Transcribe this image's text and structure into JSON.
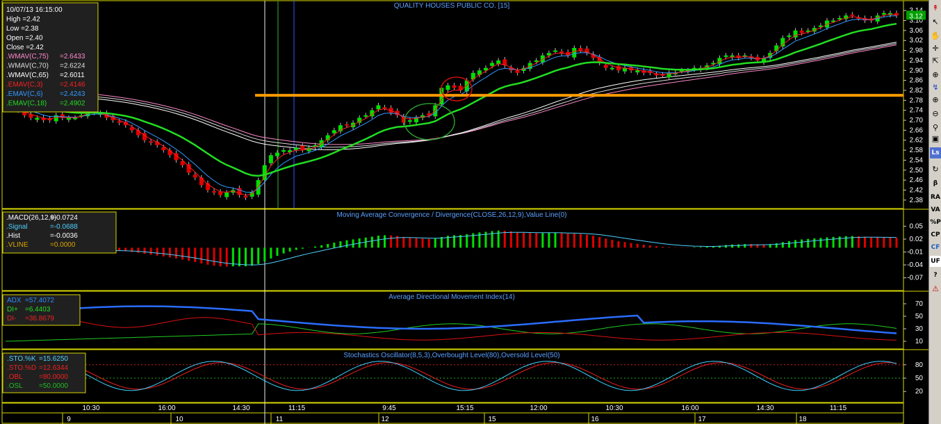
{
  "colors": {
    "background": "#000000",
    "border": "#d8d800",
    "up": "#00e000",
    "down": "#e00000",
    "title": "#5aa0ff",
    "axis_text": "#ffffff",
    "orange_level": "#ff9a00",
    "ema18": "#22dd22",
    "ema6": "#3399ff",
    "ema3": "#ff2020",
    "wmav75": "#ff88cc",
    "wmav70": "#dddddd",
    "wmav65": "#ffffff",
    "ochre": "#d9a400"
  },
  "chart_data": [
    {
      "type": "candlestick",
      "title": "QUALITY HOUSES PUBLIC CO. [15]",
      "y_ticks": [
        "3.14",
        "3.10",
        "3.06",
        "3.02",
        "2.98",
        "2.94",
        "2.90",
        "2.86",
        "2.82",
        "2.78",
        "2.74",
        "2.70",
        "2.66",
        "2.62",
        "2.58",
        "2.54",
        "2.50",
        "2.46",
        "2.42",
        "2.38"
      ],
      "last_price_label": "3.12",
      "ylim": [
        2.36,
        3.16
      ],
      "horizontal_level": 2.8,
      "closes": [
        2.77,
        2.76,
        2.74,
        2.72,
        2.71,
        2.71,
        2.7,
        2.7,
        2.72,
        2.71,
        2.71,
        2.71,
        2.72,
        2.74,
        2.73,
        2.73,
        2.71,
        2.7,
        2.69,
        2.68,
        2.66,
        2.64,
        2.62,
        2.61,
        2.6,
        2.58,
        2.56,
        2.54,
        2.52,
        2.49,
        2.47,
        2.44,
        2.42,
        2.41,
        2.4,
        2.41,
        2.42,
        2.4,
        2.39,
        2.41,
        2.46,
        2.52,
        2.56,
        2.57,
        2.58,
        2.58,
        2.59,
        2.58,
        2.59,
        2.6,
        2.62,
        2.64,
        2.66,
        2.68,
        2.68,
        2.69,
        2.71,
        2.72,
        2.74,
        2.76,
        2.75,
        2.73,
        2.72,
        2.69,
        2.7,
        2.71,
        2.72,
        2.72,
        2.76,
        2.83,
        2.84,
        2.83,
        2.82,
        2.86,
        2.89,
        2.9,
        2.91,
        2.93,
        2.94,
        2.92,
        2.9,
        2.89,
        2.91,
        2.93,
        2.94,
        2.96,
        2.97,
        2.98,
        2.97,
        2.96,
        2.99,
        2.98,
        2.97,
        2.95,
        2.93,
        2.91,
        2.91,
        2.9,
        2.91,
        2.9,
        2.9,
        2.89,
        2.89,
        2.88,
        2.88,
        2.89,
        2.89,
        2.9,
        2.9,
        2.91,
        2.91,
        2.92,
        2.93,
        2.95,
        2.96,
        2.96,
        2.95,
        2.96,
        2.95,
        2.94,
        2.95,
        2.97,
        3.0,
        3.03,
        3.04,
        3.06,
        3.05,
        3.06,
        3.07,
        3.08,
        3.1,
        3.1,
        3.11,
        3.12,
        3.12,
        3.11,
        3.1,
        3.1,
        3.12,
        3.13,
        3.13,
        3.12
      ],
      "x_time_labels": [
        "10:30",
        "16:00",
        "14:30",
        "11:15",
        "9:45",
        "15:15",
        "12:00",
        "10:30",
        "16:00",
        "14:30",
        "11:15"
      ],
      "x_day_labels": [
        "9",
        "10",
        "11",
        "12",
        "15",
        "16",
        "17",
        "18"
      ],
      "series": [
        {
          "name": ".WMAV(C,75)",
          "value": "=2.6433"
        },
        {
          "name": ".WMAV(C,70)",
          "value": "=2.6224"
        },
        {
          "name": ".WMAV(C,65)",
          "value": "=2.6011"
        },
        {
          "name": ".EMAV(C,3)",
          "value": "=2.4146"
        },
        {
          "name": ".EMAV(C,6)",
          "value": "=2.4243"
        },
        {
          "name": ".EMAV(C,18)",
          "value": "=2.4902"
        }
      ]
    },
    {
      "type": "bar",
      "title": "Moving Average Convergence / Divergence(CLOSE,26,12,9),Value Line(0)",
      "y_ticks": [
        "0.05",
        "0.02",
        "-0.01",
        "-0.04",
        "-0.07"
      ],
      "ylim": [
        -0.09,
        0.075
      ],
      "series": [
        {
          "name": ".MACD(26,12,9)",
          "value": "=-0.0724"
        },
        {
          "name": ".Signal",
          "value": "=-0.0688"
        },
        {
          "name": ".Hist",
          "value": "=-0.0036"
        },
        {
          "name": ".VLINE",
          "value": "=0.0000"
        }
      ]
    },
    {
      "type": "line",
      "title": "Average Directional Movement Index(14)",
      "y_ticks": [
        "70",
        "50",
        "30",
        "10"
      ],
      "ylim": [
        0,
        80
      ],
      "series": [
        {
          "name": "ADX",
          "value": "=57.4072"
        },
        {
          "name": "DI+",
          "value": "=6.4403"
        },
        {
          "name": "DI-",
          "value": "=36.8679"
        }
      ]
    },
    {
      "type": "line",
      "title": "Stochastics Oscillator(8,5,3),Overbought Level(80),Oversold Level(50)",
      "y_ticks": [
        "80",
        "50",
        "20"
      ],
      "ylim": [
        0,
        100
      ],
      "levels": [
        80,
        50
      ],
      "series": [
        {
          "name": ".STO.%K",
          "value": "=15.6250"
        },
        {
          "name": ".STO.%D",
          "value": "=12.6344"
        },
        {
          "name": ".OBL",
          "value": "=80.0000"
        },
        {
          "name": ".OSL",
          "value": "=50.0000"
        }
      ]
    }
  ],
  "info_box": {
    "date": "10/07/13 16:15:00",
    "high": "High  =2.42",
    "low": "Low   =2.38",
    "open": "Open  =2.40",
    "close": "Close  =2.42"
  },
  "toolbar_icons": [
    "red-arrows-icon",
    "cursor-icon",
    "hand-icon",
    "zoom-in-icon",
    "zoom-out-icon",
    "magnify-icon",
    "refresh-icon",
    "grid-icon",
    "ls-icon",
    "beta-icon",
    "ra-label",
    "va-label",
    "percent-p-label",
    "cp-label",
    "cf-label",
    "uf-label",
    "help-icon",
    "warning-icon"
  ],
  "toolbar_labels": {
    "ls": "Ls",
    "beta": "β",
    "ra": "RA",
    "va": "VA",
    "pp": "%P",
    "cp": "CP",
    "cf": "CF",
    "uf": "UF",
    "help": "?"
  }
}
